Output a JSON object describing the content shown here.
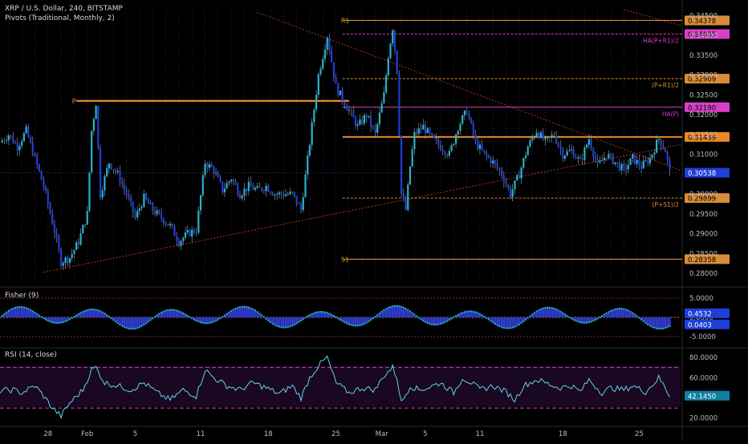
{
  "chart_data": [
    {
      "type": "candlestick",
      "title": "XRP / U.S. Dollar, 240, BITSTAMP",
      "indicator_label": "Pivots (Traditional, Monthly, 2)",
      "ylim": [
        0.277,
        0.3465
      ],
      "y_ticks": [
        "0.34500",
        "0.34000",
        "0.33500",
        "0.33000",
        "0.32500",
        "0.32000",
        "0.31500",
        "0.31000",
        "0.30500",
        "0.30000",
        "0.29500",
        "0.29000",
        "0.28500",
        "0.28000"
      ],
      "y_tick_values": [
        0.345,
        0.34,
        0.335,
        0.33,
        0.325,
        0.32,
        0.315,
        0.31,
        0.305,
        0.3,
        0.295,
        0.29,
        0.285,
        0.28
      ],
      "x_ticks": [
        "28",
        "Feb",
        "5",
        "11",
        "18",
        "25",
        "Mar",
        "5",
        "11",
        "18",
        "25"
      ],
      "current_price": "0.30538",
      "current_price_value": 0.30538,
      "price_path": [
        [
          0,
          0.313
        ],
        [
          4,
          0.315
        ],
        [
          8,
          0.312
        ],
        [
          12,
          0.316
        ],
        [
          16,
          0.309
        ],
        [
          20,
          0.302
        ],
        [
          24,
          0.293
        ],
        [
          28,
          0.283
        ],
        [
          32,
          0.284
        ],
        [
          36,
          0.288
        ],
        [
          40,
          0.295
        ],
        [
          42,
          0.316
        ],
        [
          44,
          0.323
        ],
        [
          46,
          0.3
        ],
        [
          50,
          0.308
        ],
        [
          54,
          0.305
        ],
        [
          58,
          0.3
        ],
        [
          62,
          0.294
        ],
        [
          66,
          0.299
        ],
        [
          70,
          0.296
        ],
        [
          74,
          0.294
        ],
        [
          78,
          0.292
        ],
        [
          82,
          0.288
        ],
        [
          86,
          0.29
        ],
        [
          90,
          0.291
        ],
        [
          94,
          0.308
        ],
        [
          98,
          0.306
        ],
        [
          102,
          0.301
        ],
        [
          106,
          0.304
        ],
        [
          110,
          0.3
        ],
        [
          114,
          0.302
        ],
        [
          118,
          0.301
        ],
        [
          122,
          0.302
        ],
        [
          126,
          0.3
        ],
        [
          130,
          0.3
        ],
        [
          134,
          0.3
        ],
        [
          138,
          0.296
        ],
        [
          142,
          0.313
        ],
        [
          146,
          0.33
        ],
        [
          150,
          0.34
        ],
        [
          154,
          0.327
        ],
        [
          158,
          0.323
        ],
        [
          160,
          0.321
        ],
        [
          164,
          0.317
        ],
        [
          168,
          0.32
        ],
        [
          172,
          0.315
        ],
        [
          176,
          0.325
        ],
        [
          178,
          0.335
        ],
        [
          180,
          0.342
        ],
        [
          182,
          0.331
        ],
        [
          184,
          0.3
        ],
        [
          186,
          0.296
        ],
        [
          188,
          0.307
        ],
        [
          190,
          0.315
        ],
        [
          194,
          0.317
        ],
        [
          198,
          0.314
        ],
        [
          202,
          0.312
        ],
        [
          206,
          0.31
        ],
        [
          210,
          0.317
        ],
        [
          214,
          0.321
        ],
        [
          218,
          0.313
        ],
        [
          222,
          0.31
        ],
        [
          226,
          0.308
        ],
        [
          230,
          0.305
        ],
        [
          234,
          0.3
        ],
        [
          238,
          0.305
        ],
        [
          242,
          0.312
        ],
        [
          246,
          0.316
        ],
        [
          250,
          0.313
        ],
        [
          254,
          0.315
        ],
        [
          258,
          0.31
        ],
        [
          262,
          0.311
        ],
        [
          266,
          0.308
        ],
        [
          270,
          0.314
        ],
        [
          274,
          0.307
        ],
        [
          278,
          0.31
        ],
        [
          282,
          0.308
        ],
        [
          286,
          0.306
        ],
        [
          290,
          0.309
        ],
        [
          294,
          0.307
        ],
        [
          298,
          0.309
        ],
        [
          302,
          0.314
        ],
        [
          305,
          0.311
        ],
        [
          307,
          0.3054
        ]
      ],
      "pivots": [
        {
          "label": "R1",
          "value": 0.34378,
          "value_text": "0.34378",
          "color": "#d98c3a",
          "style": "solid"
        },
        {
          "label": "HA(P+R1)/2",
          "value": 0.34035,
          "value_text": "0.34035",
          "color": "#d640c8",
          "style": "dashed"
        },
        {
          "label": "(P+R1)/2",
          "value": 0.32909,
          "value_text": "0.32909",
          "color": "#d98c3a",
          "style": "dashed"
        },
        {
          "label": "HA(P)",
          "value": 0.3219,
          "value_text": "0.32190",
          "color": "#d640c8",
          "style": "solid"
        },
        {
          "label": "",
          "value": 0.31439,
          "value_text": "0.31439",
          "color": "#e8882a",
          "style": "solid"
        },
        {
          "label": "(P+S1)/2",
          "value": 0.29899,
          "value_text": "0.29899",
          "color": "#d98c3a",
          "style": "dashed"
        },
        {
          "label": "S1",
          "value": 0.28358,
          "value_text": "0.28358",
          "color": "#d98c3a",
          "style": "solid"
        }
      ],
      "previous_pivot": {
        "label": "P",
        "value": 0.3235
      }
    },
    {
      "type": "histogram",
      "title": "Fisher (9)",
      "ylim": [
        -7.5,
        7.5
      ],
      "y_ticks": [
        "5.0000",
        "0.0000",
        "-5.0000"
      ],
      "y_tick_values": [
        5,
        0,
        -5
      ],
      "current_values": [
        {
          "text": "0.4532",
          "value": 0.4532,
          "color": "#2f39c9"
        },
        {
          "text": "0.0403",
          "value": 0.0403,
          "color": "#2f39c9"
        }
      ],
      "reference_lines": [
        5.0,
        0.0,
        -5.0
      ]
    },
    {
      "type": "line",
      "title": "RSI (14, close)",
      "ylim": [
        15,
        88
      ],
      "y_ticks": [
        "80.0000",
        "60.0000",
        "40.0000",
        "20.0000"
      ],
      "y_tick_values": [
        80,
        60,
        40,
        20
      ],
      "bands": [
        70,
        30
      ],
      "current_value": "42.1450",
      "current_value_num": 42.145,
      "rsi_path": [
        [
          0,
          47
        ],
        [
          6,
          48
        ],
        [
          10,
          45
        ],
        [
          16,
          52
        ],
        [
          20,
          42
        ],
        [
          24,
          30
        ],
        [
          28,
          22
        ],
        [
          32,
          35
        ],
        [
          38,
          48
        ],
        [
          42,
          68
        ],
        [
          44,
          70
        ],
        [
          48,
          55
        ],
        [
          54,
          52
        ],
        [
          60,
          48
        ],
        [
          66,
          55
        ],
        [
          72,
          45
        ],
        [
          78,
          38
        ],
        [
          84,
          48
        ],
        [
          90,
          42
        ],
        [
          94,
          68
        ],
        [
          98,
          60
        ],
        [
          104,
          52
        ],
        [
          110,
          48
        ],
        [
          116,
          55
        ],
        [
          122,
          50
        ],
        [
          128,
          44
        ],
        [
          134,
          52
        ],
        [
          138,
          40
        ],
        [
          142,
          60
        ],
        [
          146,
          72
        ],
        [
          150,
          80
        ],
        [
          154,
          55
        ],
        [
          160,
          45
        ],
        [
          166,
          50
        ],
        [
          172,
          48
        ],
        [
          176,
          62
        ],
        [
          180,
          70
        ],
        [
          182,
          60
        ],
        [
          184,
          35
        ],
        [
          188,
          52
        ],
        [
          192,
          48
        ],
        [
          196,
          50
        ],
        [
          202,
          55
        ],
        [
          208,
          45
        ],
        [
          212,
          60
        ],
        [
          216,
          55
        ],
        [
          220,
          48
        ],
        [
          226,
          52
        ],
        [
          232,
          46
        ],
        [
          236,
          38
        ],
        [
          240,
          52
        ],
        [
          246,
          58
        ],
        [
          250,
          55
        ],
        [
          256,
          50
        ],
        [
          262,
          52
        ],
        [
          266,
          46
        ],
        [
          270,
          58
        ],
        [
          276,
          45
        ],
        [
          280,
          50
        ],
        [
          286,
          48
        ],
        [
          290,
          52
        ],
        [
          296,
          46
        ],
        [
          300,
          55
        ],
        [
          302,
          60
        ],
        [
          305,
          50
        ],
        [
          307,
          42
        ]
      ]
    }
  ]
}
